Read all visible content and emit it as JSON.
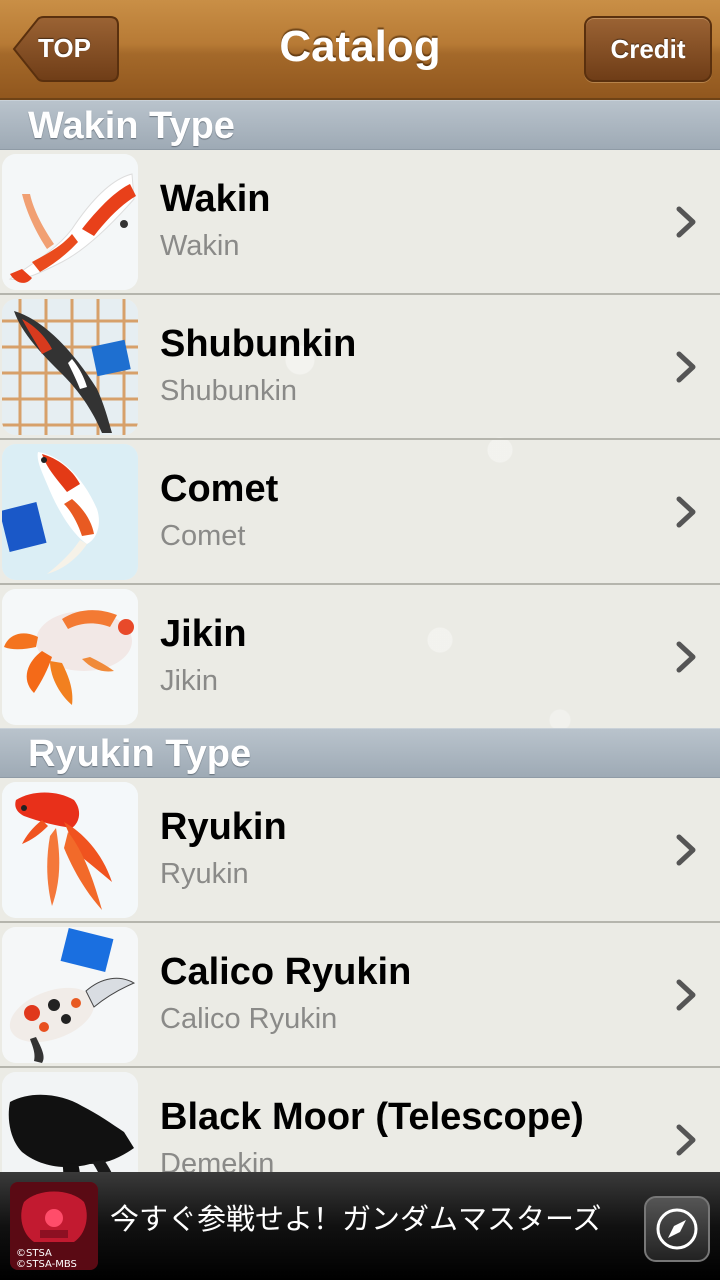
{
  "navbar": {
    "title": "Catalog",
    "back_label": "TOP",
    "credit_label": "Credit"
  },
  "sections": [
    {
      "header": "Wakin Type",
      "items": [
        {
          "title": "Wakin",
          "subtitle": "Wakin",
          "thumb": "red-white-goldfish"
        },
        {
          "title": "Shubunkin",
          "subtitle": "Shubunkin",
          "thumb": "calico-goldfish-in-net"
        },
        {
          "title": "Comet",
          "subtitle": "Comet",
          "thumb": "red-white-comet"
        },
        {
          "title": "Jikin",
          "subtitle": "Jikin",
          "thumb": "jikin-goldfish"
        }
      ]
    },
    {
      "header": "Ryukin Type",
      "items": [
        {
          "title": "Ryukin",
          "subtitle": "Ryukin",
          "thumb": "red-ryukin"
        },
        {
          "title": "Calico Ryukin",
          "subtitle": "Calico Ryukin",
          "thumb": "calico-ryukin"
        },
        {
          "title": "Black Moor (Telescope)",
          "subtitle": "Demekin",
          "thumb": "black-moor"
        }
      ]
    }
  ],
  "ad": {
    "text": "今すぐ参戦せよ！ガンダムマスターズ",
    "image_caption": "©STSA ©STSA-MBS",
    "icon": "compass-icon"
  },
  "colors": {
    "nav_brown": "#b77a35",
    "section_header": "#9eaab5",
    "subtitle_gray": "#8a8a88"
  }
}
